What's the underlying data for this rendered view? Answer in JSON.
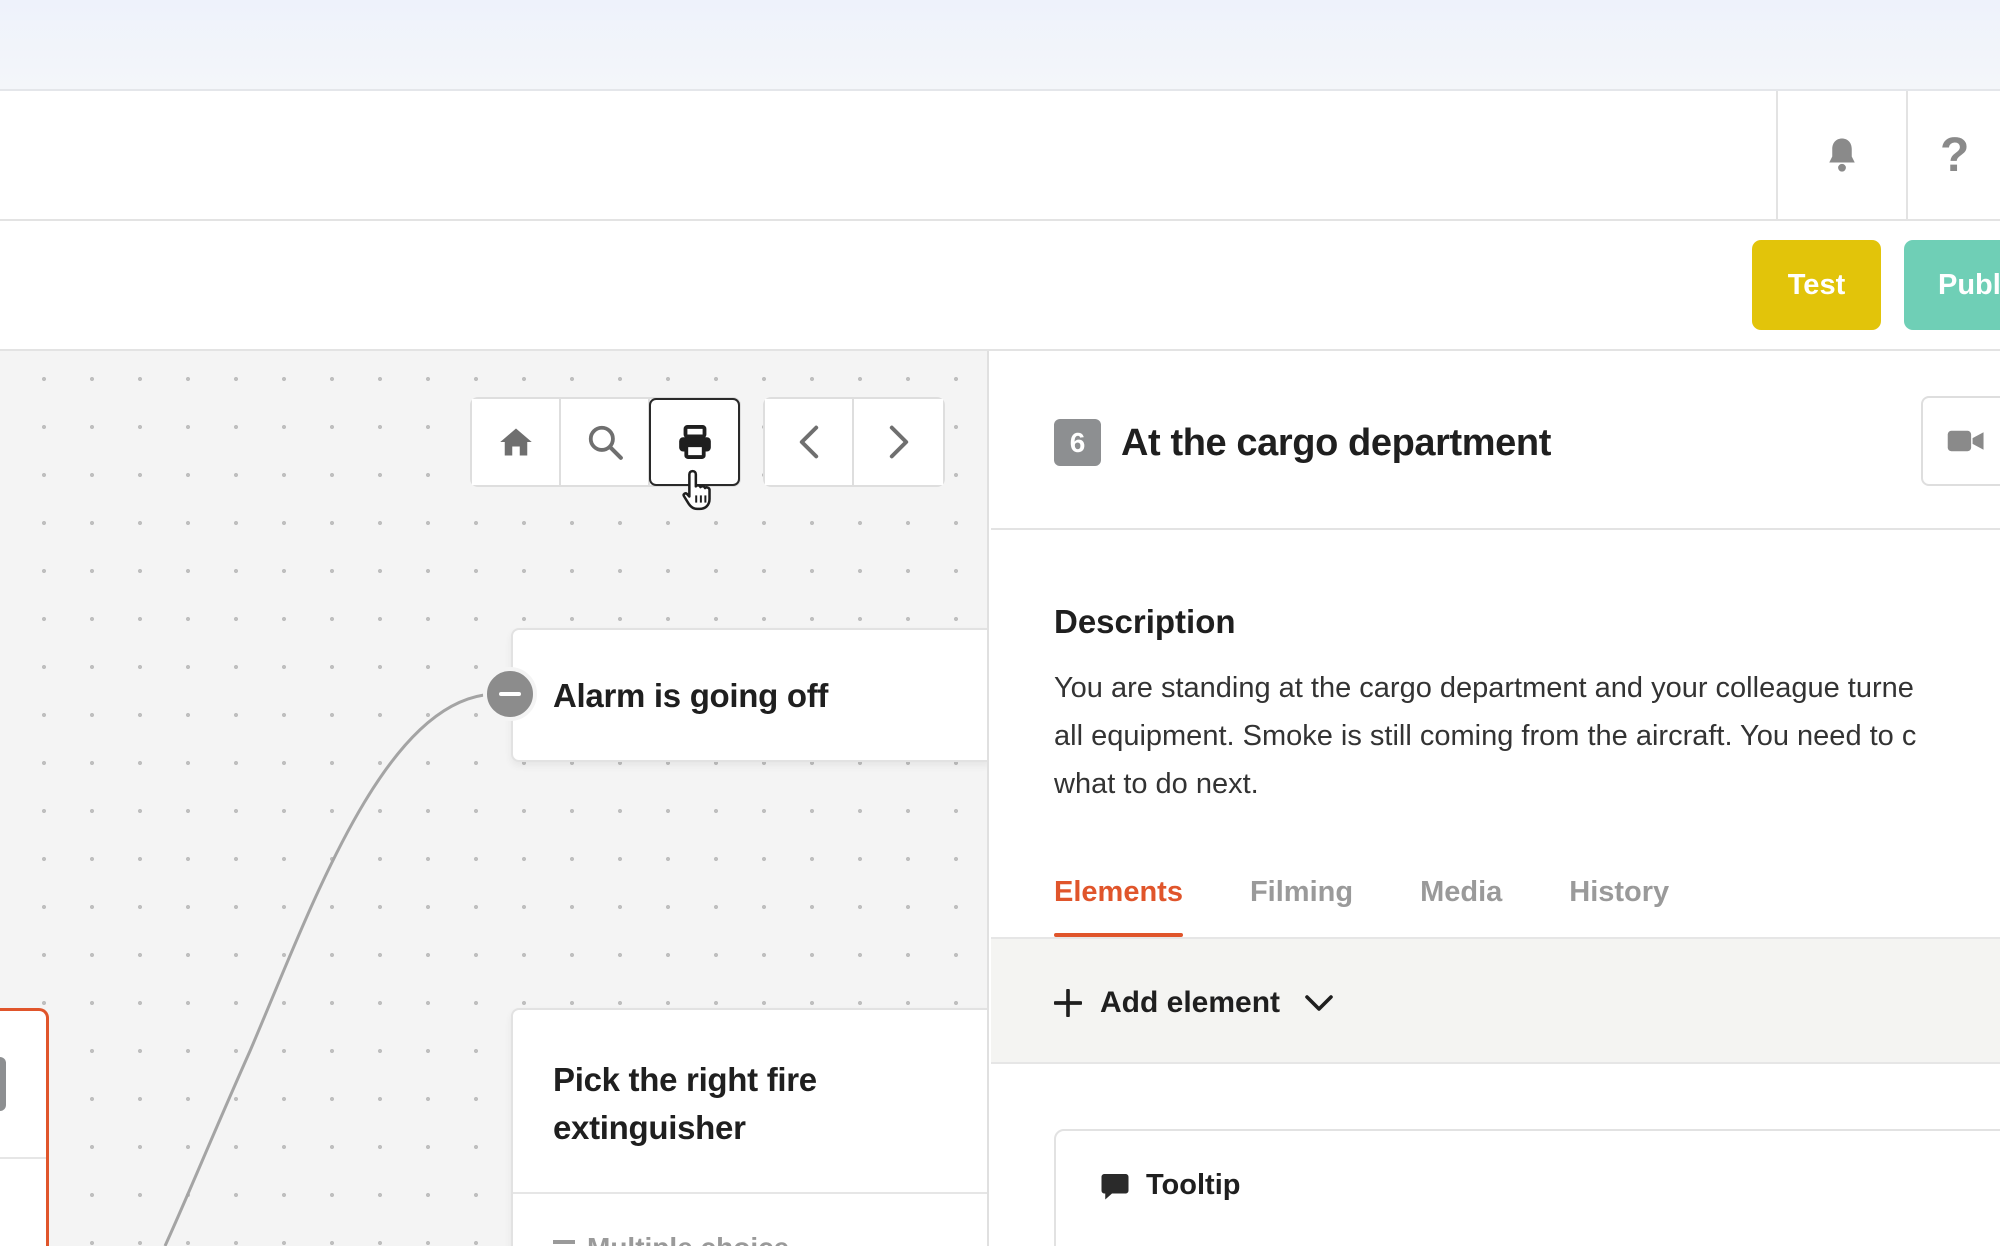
{
  "header": {
    "icons": {
      "notifications": "bell-icon",
      "help": "question-icon"
    },
    "help_glyph": "?"
  },
  "actions": {
    "test_label": "Test",
    "publish_label": "Publ"
  },
  "canvas": {
    "toolbar_icons": [
      "home-icon",
      "search-icon",
      "print-icon",
      "chevron-left-icon",
      "chevron-right-icon"
    ],
    "nodes": [
      {
        "title": "Alarm is going off"
      },
      {
        "title": "Pick the right fire extinguisher",
        "sub_label": "Multiple choice"
      }
    ]
  },
  "panel": {
    "step_number": "6",
    "step_title": "At the cargo department",
    "description_heading": "Description",
    "description_text": "You are standing at the cargo department and your colleague turne\nall equipment. Smoke is still coming from the aircraft. You need to c\nwhat to do next.",
    "tabs": [
      {
        "label": "Elements",
        "active": true
      },
      {
        "label": "Filming",
        "active": false
      },
      {
        "label": "Media",
        "active": false
      },
      {
        "label": "History",
        "active": false
      }
    ],
    "add_element_label": "Add element",
    "tooltip_label": "Tooltip"
  },
  "colors": {
    "accent": "#e0552b",
    "test_button": "#e2c40a",
    "publish_button": "#6fcfb6",
    "badge": "#8d8f91"
  }
}
